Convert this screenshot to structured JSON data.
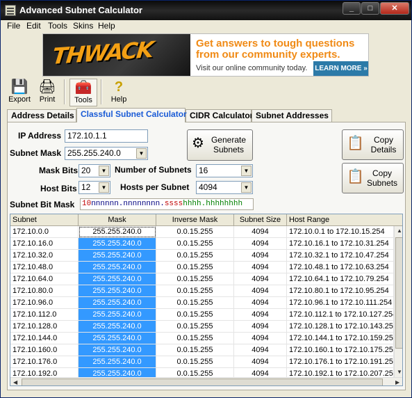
{
  "window": {
    "title": "Advanced Subnet Calculator",
    "controls": [
      "_",
      "□",
      "✕"
    ]
  },
  "menu": [
    "File",
    "Edit",
    "Tools",
    "Skins",
    "Help"
  ],
  "banner": {
    "logo": "THWACK",
    "headline": "Get answers to tough questions from our community experts.",
    "subtext": "Visit our online community today.",
    "cta": "LEARN MORE »"
  },
  "toolbar": {
    "export": "Export",
    "print": "Print",
    "tools": "Tools",
    "help": "Help"
  },
  "tabs": [
    "Address Details",
    "Classful Subnet Calculator",
    "CIDR Calculator",
    "Subnet Addresses"
  ],
  "active_tab": 1,
  "form": {
    "ip_address_label": "IP Address",
    "ip_address": "172.10.1.1",
    "subnet_mask_label": "Subnet Mask",
    "subnet_mask": "255.255.240.0",
    "mask_bits_label": "Mask Bits",
    "mask_bits": "20",
    "host_bits_label": "Host Bits",
    "host_bits": "12",
    "num_subnets_label": "Number of Subnets",
    "num_subnets": "16",
    "hosts_per_subnet_label": "Hosts per Subnet",
    "hosts_per_subnet": "4094",
    "bit_mask_label": "Subnet Bit Mask",
    "bit_mask": {
      "net": "10",
      "cls": "nnnnnn.nnnnnnnn.",
      "sub": "ssss",
      "host": "hhhh.hhhhhhhh"
    },
    "generate_label": "Generate Subnets",
    "copy_details_label": "Copy Details",
    "copy_subnets_label": "Copy Subnets"
  },
  "grid": {
    "columns": [
      "Subnet",
      "Mask",
      "Inverse Mask",
      "Subnet Size",
      "Host Range"
    ],
    "rows": [
      [
        "172.10.0.0",
        "255.255.240.0",
        "0.0.15.255",
        "4094",
        "172.10.0.1  to  172.10.15.254"
      ],
      [
        "172.10.16.0",
        "255.255.240.0",
        "0.0.15.255",
        "4094",
        "172.10.16.1  to  172.10.31.254"
      ],
      [
        "172.10.32.0",
        "255.255.240.0",
        "0.0.15.255",
        "4094",
        "172.10.32.1  to  172.10.47.254"
      ],
      [
        "172.10.48.0",
        "255.255.240.0",
        "0.0.15.255",
        "4094",
        "172.10.48.1  to  172.10.63.254"
      ],
      [
        "172.10.64.0",
        "255.255.240.0",
        "0.0.15.255",
        "4094",
        "172.10.64.1  to  172.10.79.254"
      ],
      [
        "172.10.80.0",
        "255.255.240.0",
        "0.0.15.255",
        "4094",
        "172.10.80.1  to  172.10.95.254"
      ],
      [
        "172.10.96.0",
        "255.255.240.0",
        "0.0.15.255",
        "4094",
        "172.10.96.1  to  172.10.111.254"
      ],
      [
        "172.10.112.0",
        "255.255.240.0",
        "0.0.15.255",
        "4094",
        "172.10.112.1  to  172.10.127.254"
      ],
      [
        "172.10.128.0",
        "255.255.240.0",
        "0.0.15.255",
        "4094",
        "172.10.128.1  to  172.10.143.254"
      ],
      [
        "172.10.144.0",
        "255.255.240.0",
        "0.0.15.255",
        "4094",
        "172.10.144.1  to  172.10.159.254"
      ],
      [
        "172.10.160.0",
        "255.255.240.0",
        "0.0.15.255",
        "4094",
        "172.10.160.1  to  172.10.175.254"
      ],
      [
        "172.10.176.0",
        "255.255.240.0",
        "0.0.15.255",
        "4094",
        "172.10.176.1  to  172.10.191.254"
      ],
      [
        "172.10.192.0",
        "255.255.240.0",
        "0.0.15.255",
        "4094",
        "172.10.192.1  to  172.10.207.254"
      ]
    ]
  }
}
